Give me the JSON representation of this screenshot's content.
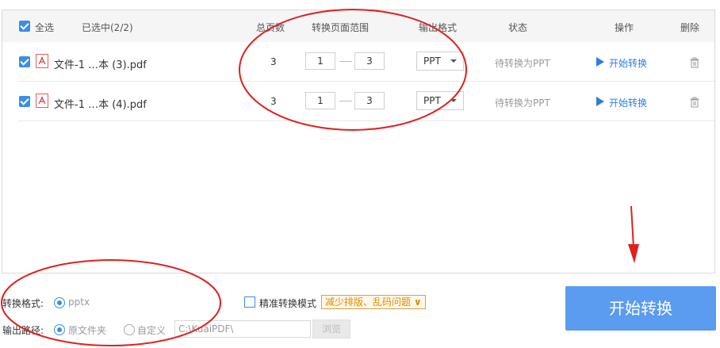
{
  "header": {
    "select_all": "全选",
    "selected_count": "已选中(2/2)",
    "col_total_pages": "总页数",
    "col_page_range": "转换页面范围",
    "col_output_format": "输出格式",
    "col_status": "状态",
    "col_action": "操作",
    "col_delete": "删除"
  },
  "files": [
    {
      "name": "文件-1 …本 (3).pdf",
      "total_pages": "3",
      "range_start": "1",
      "range_end": "3",
      "format": "PPT",
      "status": "待转换为PPT",
      "action": "开始转换"
    },
    {
      "name": "文件-1 …本 (4).pdf",
      "total_pages": "3",
      "range_start": "1",
      "range_end": "3",
      "format": "PPT",
      "status": "待转换为PPT",
      "action": "开始转换"
    }
  ],
  "bottom": {
    "format_label": "转换格式:",
    "format_option": "pptx",
    "precise_mode_label": "精准转换模式",
    "precise_tip": "减少排版、乱码问题",
    "output_path_label": "输出路径:",
    "option_source_folder": "原文件夹",
    "option_custom": "自定义",
    "path_value": "C:\\KuaiPDF\\",
    "browse_button": "浏览",
    "start_button": "开始转换"
  },
  "colors": {
    "accent": "#3a8ee6",
    "start_button": "#5b9bf0",
    "annotation_red": "#e02020",
    "tip_orange": "#e08a00"
  }
}
